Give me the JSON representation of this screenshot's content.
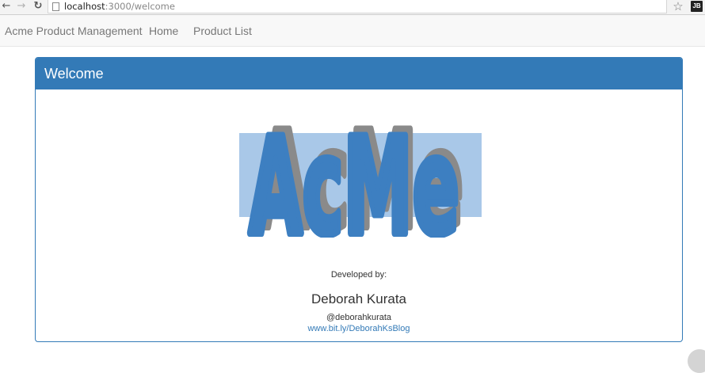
{
  "browser": {
    "url_host": "localhost",
    "url_path": ":3000/welcome",
    "back_icon": "arrow-left-icon",
    "forward_icon": "arrow-right-icon",
    "reload_icon": "reload-icon",
    "bookmark_icon": "star-icon",
    "extension_label": "JB"
  },
  "navbar": {
    "brand": "Acme Product Management",
    "links": [
      "Home",
      "Product List"
    ]
  },
  "panel": {
    "title": "Welcome",
    "logo_text": "AcMe",
    "developed_by": "Developed by:",
    "author_name": "Deborah Kurata",
    "author_handle": "@deborahkurata",
    "author_link": "www.bit.ly/DeborahKsBlog"
  },
  "colors": {
    "primary": "#337ab7",
    "logo_blue": "#3d7fc1",
    "logo_box": "#a9c8e8",
    "logo_shadow": "#8a8a8a"
  }
}
